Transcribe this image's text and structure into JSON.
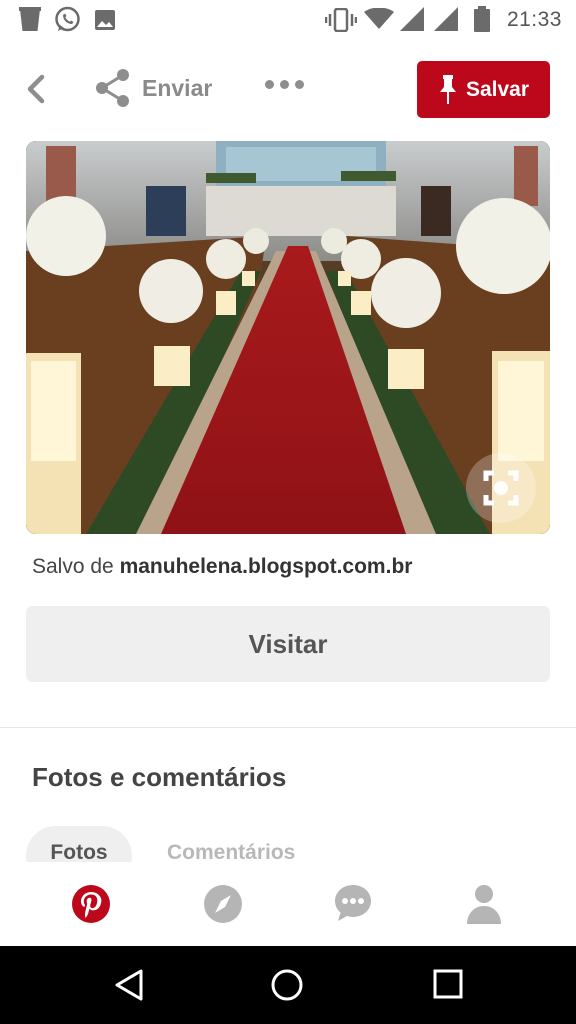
{
  "status_bar": {
    "time": "21:33",
    "left_icons": [
      "trash-icon",
      "whatsapp-icon",
      "image-icon"
    ],
    "right_icons": [
      "vibrate-icon",
      "wifi-icon",
      "signal-icon",
      "signal-icon",
      "battery-icon"
    ]
  },
  "header": {
    "share_label": "Enviar",
    "save_label": "Salvar"
  },
  "pin": {
    "saved_prefix": "Salvo de",
    "source_domain": "manuhelena.blogspot.com.br",
    "visit_label": "Visitar"
  },
  "comments_section": {
    "title": "Fotos e comentários",
    "tabs": [
      {
        "label": "Fotos",
        "active": true
      },
      {
        "label": "Comentários",
        "active": false
      }
    ]
  },
  "bottom_nav": {
    "items": [
      "pinterest-home-icon",
      "explore-compass-icon",
      "messages-icon",
      "profile-icon"
    ],
    "active_color": "#bd081c",
    "inactive_color": "#b5b5b5"
  },
  "colors": {
    "brand_red": "#bd081c",
    "button_gray": "#efefef"
  }
}
